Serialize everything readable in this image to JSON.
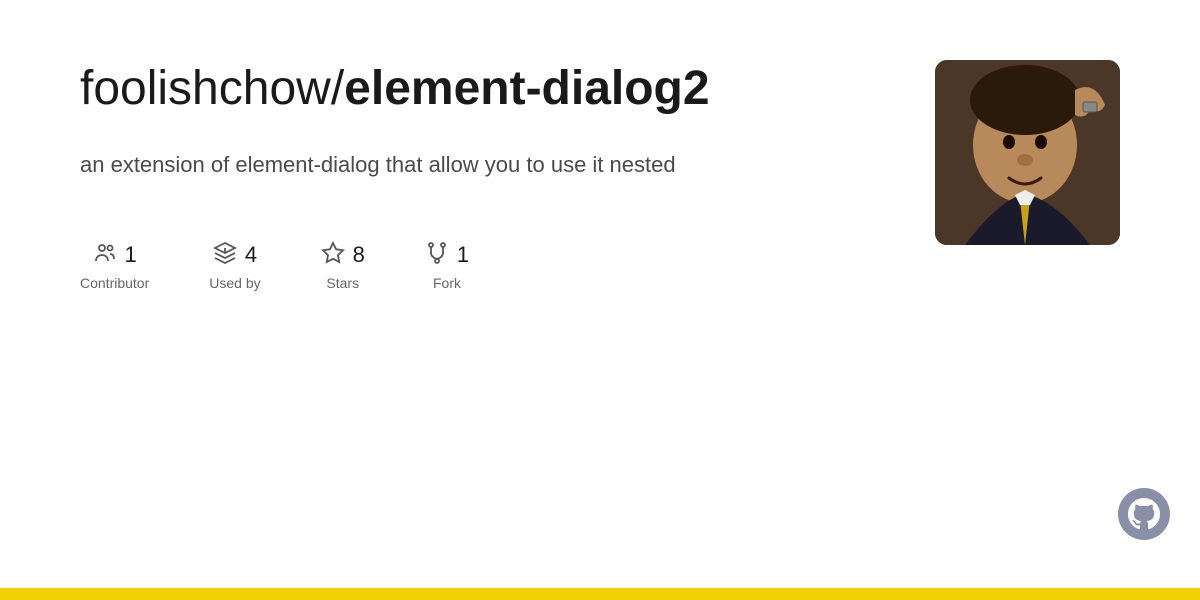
{
  "repo": {
    "owner": "foolishchow",
    "name": "element-dialog2",
    "description": "an extension of element-dialog that allow you to use it nested"
  },
  "stats": [
    {
      "id": "contributors",
      "number": "1",
      "label": "Contributor",
      "icon": "contributors-icon"
    },
    {
      "id": "used-by",
      "number": "4",
      "label": "Used by",
      "icon": "package-icon"
    },
    {
      "id": "stars",
      "number": "8",
      "label": "Stars",
      "icon": "star-icon"
    },
    {
      "id": "forks",
      "number": "1",
      "label": "Fork",
      "icon": "fork-icon"
    }
  ],
  "accent_color": "#f0d000",
  "github_icon": "github-icon"
}
